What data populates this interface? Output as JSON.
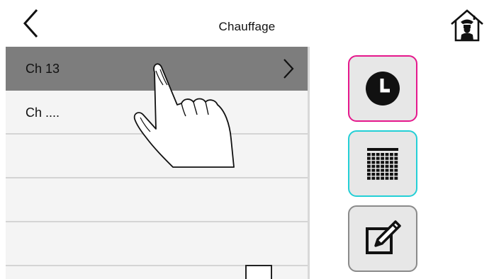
{
  "header": {
    "title": "Chauffage",
    "back_icon": "chevron-left-icon",
    "home_icon": "home-burglar-icon"
  },
  "list": {
    "items": [
      {
        "label": "Ch 13",
        "selected": true
      },
      {
        "label": "Ch ....",
        "selected": false
      },
      {
        "label": "",
        "selected": false
      },
      {
        "label": "",
        "selected": false
      },
      {
        "label": "",
        "selected": false
      }
    ]
  },
  "side_buttons": [
    {
      "icon": "clock-icon",
      "border_color": "#e5188c"
    },
    {
      "icon": "calendar-grid-icon",
      "border_color": "#23cfd6"
    },
    {
      "icon": "edit-icon",
      "border_color": "#8a8a8a"
    }
  ],
  "colors": {
    "selected_row": "#7d7d7d",
    "list_bg": "#f4f4f4",
    "button_bg": "#e7e7e7"
  }
}
